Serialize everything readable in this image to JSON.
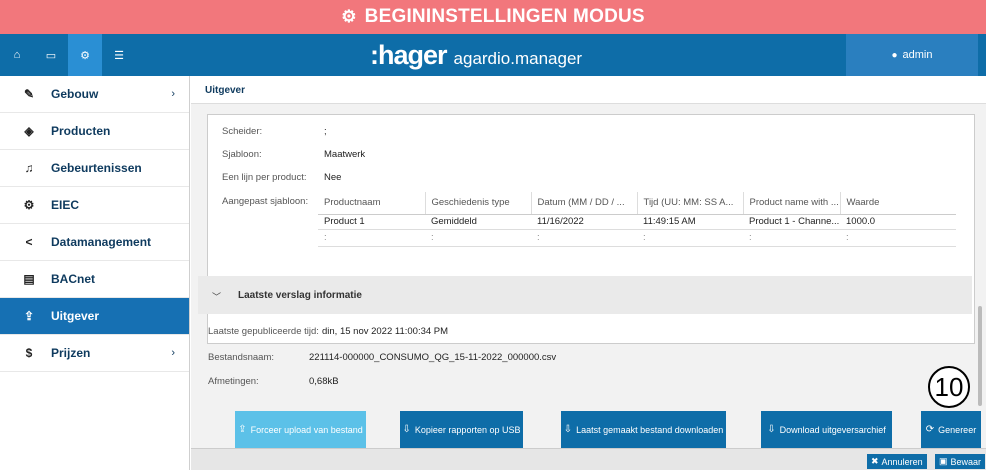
{
  "banner": {
    "title": "BEGININSTELLINGEN MODUS"
  },
  "topbar": {
    "brand": ":hager",
    "app": "agardio.manager",
    "user": "admin"
  },
  "sidebar": {
    "items": [
      {
        "label": "Gebouw",
        "icon": "wrench-icon",
        "chevron": "›"
      },
      {
        "label": "Producten",
        "icon": "cube-icon",
        "chevron": ""
      },
      {
        "label": "Gebeurtenissen",
        "icon": "bell-icon",
        "chevron": ""
      },
      {
        "label": "EIEC",
        "icon": "gears-icon",
        "chevron": ""
      },
      {
        "label": "Datamanagement",
        "icon": "share-icon",
        "chevron": ""
      },
      {
        "label": "BACnet",
        "icon": "server-icon",
        "chevron": ""
      },
      {
        "label": "Uitgever",
        "icon": "upload-icon",
        "chevron": ""
      },
      {
        "label": "Prijzen",
        "icon": "dollar-icon",
        "chevron": "›"
      }
    ]
  },
  "page": {
    "title": "Uitgever"
  },
  "config": {
    "scheider_label": "Scheider:",
    "scheider_value": ";",
    "sjabloon_label": "Sjabloon:",
    "sjabloon_value": "Maatwerk",
    "lijn_label": "Een lijn per product:",
    "lijn_value": "Nee",
    "aangepast_label": "Aangepast sjabloon:"
  },
  "table": {
    "columns": [
      "Productnaam",
      "Geschiedenis type",
      "Datum (MM / DD / ...",
      "Tijd (UU: MM: SS A...",
      "Product name with ...",
      "Waarde"
    ],
    "row": [
      "Product 1",
      "Gemiddeld",
      "11/16/2022",
      "11:49:15 AM",
      "Product 1 - Channe...",
      "1000.0"
    ],
    "more": [
      ":",
      ":",
      ":",
      ":",
      ":",
      ":"
    ]
  },
  "report": {
    "section_title": "Laatste verslag informatie",
    "published_label": "Laatste gepubliceerde tijd:",
    "published_value": "din, 15 nov 2022 11:00:34 PM",
    "file_label": "Bestandsnaam:",
    "file_value": "221114-000000_CONSUMO_QG_15-11-2022_000000.csv",
    "size_label": "Afmetingen:",
    "size_value": "0,68kB"
  },
  "buttons": {
    "force": "Forceer upload van bestand",
    "copy": "Kopieer rapporten op USB",
    "download_last": "Laatst gemaakt bestand downloaden",
    "download_archive": "Download uitgeversarchief",
    "generate": "Genereer",
    "cancel": "Annuleren",
    "save": "Bewaar"
  },
  "annotation": {
    "step": "10"
  },
  "colors": {
    "banner": "#f2777c",
    "topbar": "#0e6da8",
    "active": "#1670b3",
    "light_button": "#5cc1e8"
  }
}
